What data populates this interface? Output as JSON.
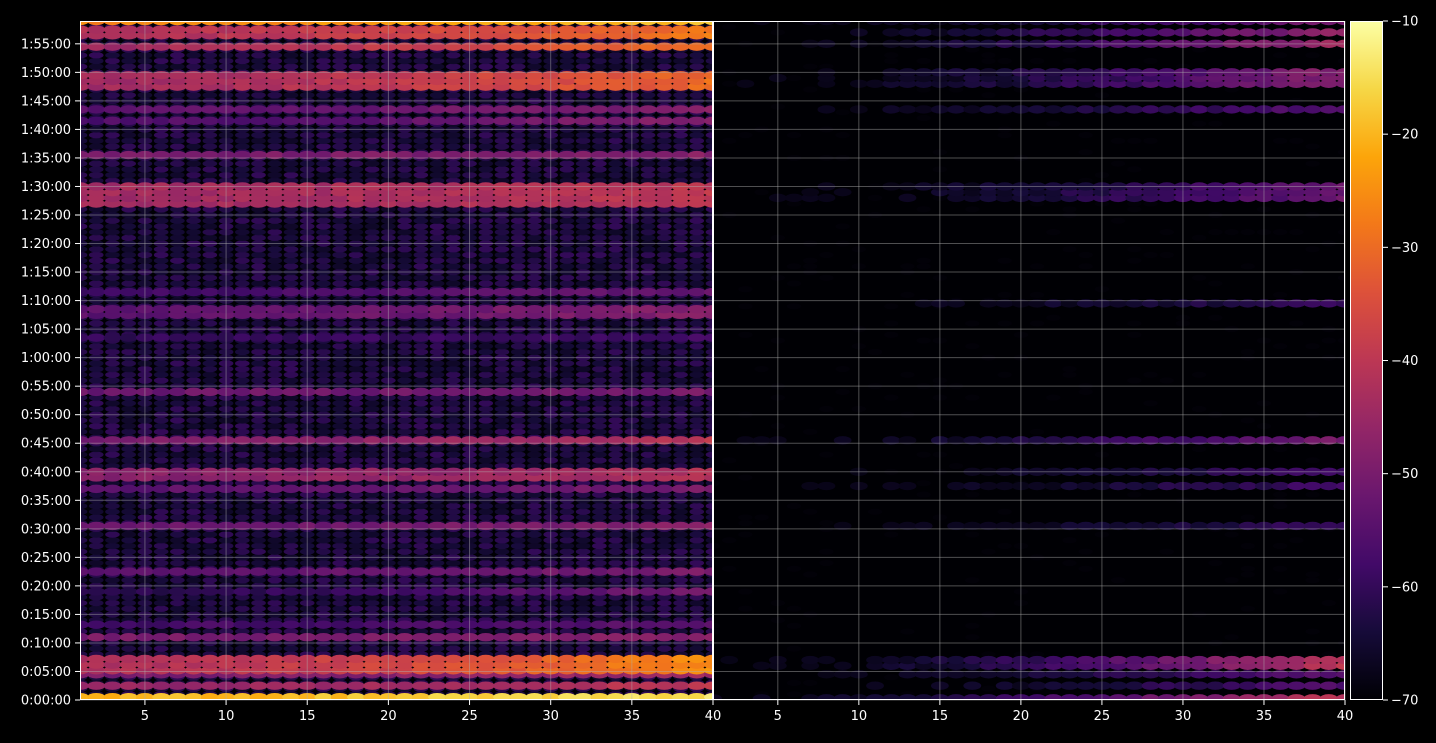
{
  "chart_data": {
    "type": "heatmap",
    "title": "",
    "xlabel": "",
    "ylabel": "",
    "grid": true,
    "legend": "colorbar-right",
    "colormap": "inferno",
    "colorbar": {
      "min": -70,
      "max": -10,
      "ticks": [
        -10,
        -20,
        -30,
        -40,
        -50,
        -60,
        -70
      ],
      "tick_labels": [
        "−10",
        "−20",
        "−30",
        "−40",
        "−50",
        "−60",
        "−70"
      ]
    },
    "y_ticks": [
      "0:00:00",
      "0:05:00",
      "0:10:00",
      "0:15:00",
      "0:20:00",
      "0:25:00",
      "0:30:00",
      "0:35:00",
      "0:40:00",
      "0:45:00",
      "0:50:00",
      "0:55:00",
      "1:00:00",
      "1:05:00",
      "1:10:00",
      "1:15:00",
      "1:20:00",
      "1:25:00",
      "1:30:00",
      "1:35:00",
      "1:40:00",
      "1:45:00",
      "1:50:00",
      "1:55:00"
    ],
    "y_range_minutes": [
      0,
      119
    ],
    "panels": [
      {
        "name": "left",
        "xlim": [
          1,
          40
        ],
        "x_ticks": [
          5,
          10,
          15,
          20,
          25,
          30,
          35,
          40
        ],
        "bands": [
          {
            "t": 0.5,
            "w": 1.2,
            "v": [
              -20,
              -14
            ]
          },
          {
            "t": 2.5,
            "w": 1.2,
            "v": [
              -46,
              -40
            ]
          },
          {
            "t": 4.5,
            "w": 1.2,
            "v": [
              -50,
              -44
            ]
          },
          {
            "t": 6.2,
            "w": 2.6,
            "v": [
              -42,
              -25
            ]
          },
          {
            "t": 11.0,
            "w": 1.0,
            "v": [
              -50,
              -48
            ]
          },
          {
            "t": 13.2,
            "w": 1.0,
            "v": [
              -58,
              -54
            ]
          },
          {
            "t": 19.0,
            "w": 1.0,
            "v": [
              -62,
              -50
            ]
          },
          {
            "t": 22.5,
            "w": 1.4,
            "v": [
              -54,
              -50
            ]
          },
          {
            "t": 30.5,
            "w": 1.0,
            "v": [
              -52,
              -48
            ]
          },
          {
            "t": 37.0,
            "w": 1.4,
            "v": [
              -54,
              -50
            ]
          },
          {
            "t": 39.5,
            "w": 1.6,
            "v": [
              -48,
              -42
            ]
          },
          {
            "t": 45.5,
            "w": 1.0,
            "v": [
              -50,
              -40
            ]
          },
          {
            "t": 54.0,
            "w": 1.0,
            "v": [
              -52,
              -50
            ]
          },
          {
            "t": 63.5,
            "w": 1.0,
            "v": [
              -60,
              -58
            ]
          },
          {
            "t": 68.0,
            "w": 2.0,
            "v": [
              -54,
              -48
            ]
          },
          {
            "t": 71.5,
            "w": 1.0,
            "v": [
              -58,
              -52
            ]
          },
          {
            "t": 88.5,
            "w": 3.6,
            "v": [
              -44,
              -40
            ]
          },
          {
            "t": 95.5,
            "w": 1.0,
            "v": [
              -50,
              -48
            ]
          },
          {
            "t": 101.5,
            "w": 1.0,
            "v": [
              -56,
              -48
            ]
          },
          {
            "t": 103.5,
            "w": 1.0,
            "v": [
              -54,
              -48
            ]
          },
          {
            "t": 108.5,
            "w": 2.6,
            "v": [
              -44,
              -30
            ]
          },
          {
            "t": 114.5,
            "w": 1.2,
            "v": [
              -44,
              -28
            ]
          },
          {
            "t": 117.0,
            "w": 1.6,
            "v": [
              -42,
              -28
            ]
          },
          {
            "t": 119.0,
            "w": 1.0,
            "v": [
              -26,
              -18
            ]
          }
        ]
      },
      {
        "name": "right",
        "xlim": [
          1,
          40
        ],
        "x_ticks": [
          5,
          10,
          15,
          20,
          25,
          30,
          35,
          40
        ],
        "bands": [
          {
            "t": 0.3,
            "w": 0.8,
            "v": [
              -68,
              -40
            ]
          },
          {
            "t": 2.5,
            "w": 1.0,
            "v": [
              -70,
              -56
            ]
          },
          {
            "t": 4.5,
            "w": 1.0,
            "v": [
              -70,
              -54
            ]
          },
          {
            "t": 6.5,
            "w": 2.2,
            "v": [
              -70,
              -40
            ]
          },
          {
            "t": 30.5,
            "w": 0.8,
            "v": [
              -70,
              -60
            ]
          },
          {
            "t": 37.5,
            "w": 1.2,
            "v": [
              -70,
              -58
            ]
          },
          {
            "t": 40.0,
            "w": 1.2,
            "v": [
              -70,
              -58
            ]
          },
          {
            "t": 45.5,
            "w": 0.8,
            "v": [
              -70,
              -50
            ]
          },
          {
            "t": 69.5,
            "w": 0.8,
            "v": [
              -70,
              -60
            ]
          },
          {
            "t": 89.0,
            "w": 3.0,
            "v": [
              -70,
              -52
            ]
          },
          {
            "t": 103.5,
            "w": 0.8,
            "v": [
              -70,
              -54
            ]
          },
          {
            "t": 109.0,
            "w": 2.6,
            "v": [
              -70,
              -48
            ]
          },
          {
            "t": 115.0,
            "w": 1.2,
            "v": [
              -70,
              -44
            ]
          },
          {
            "t": 117.0,
            "w": 1.4,
            "v": [
              -70,
              -46
            ]
          },
          {
            "t": 119.0,
            "w": 0.8,
            "v": [
              -70,
              -50
            ]
          }
        ]
      }
    ]
  }
}
